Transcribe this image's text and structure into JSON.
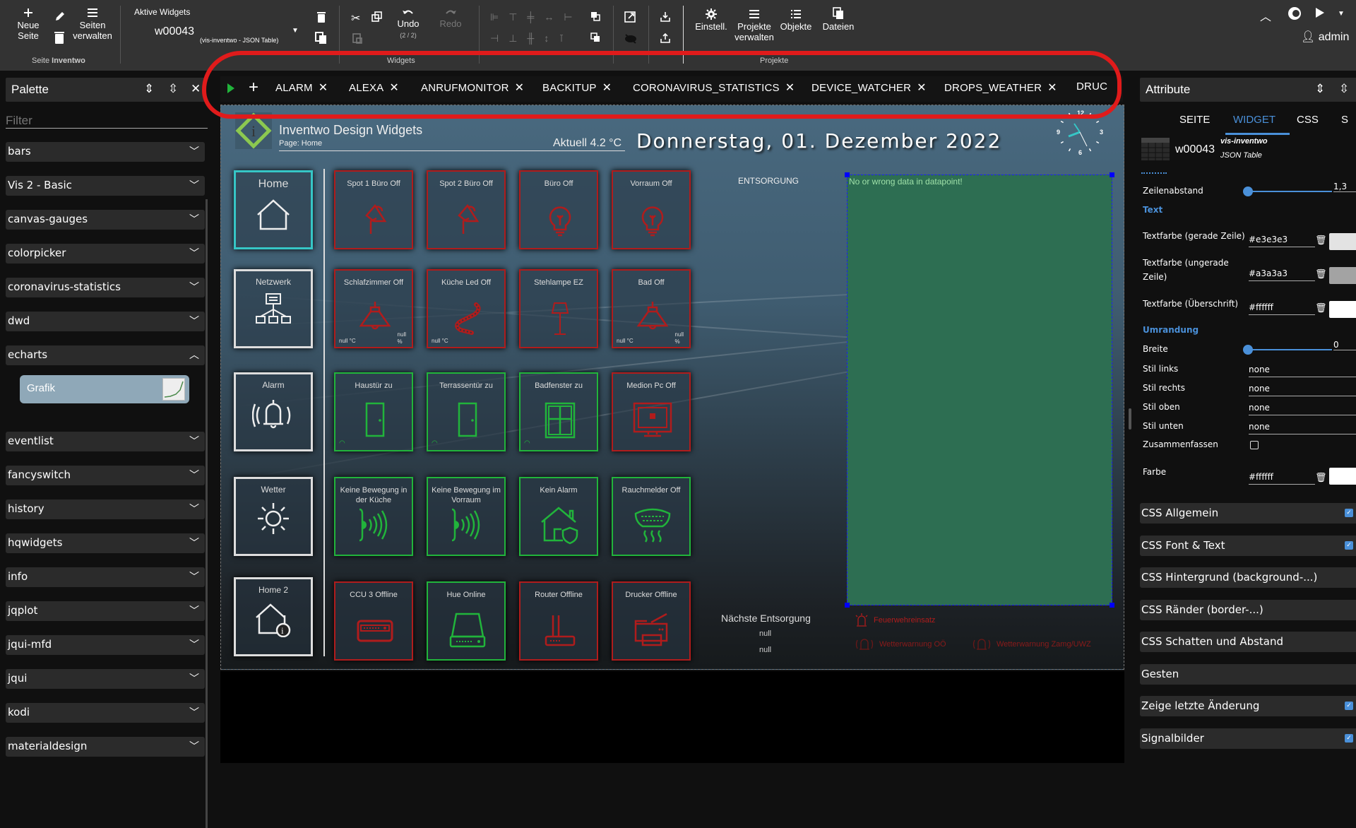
{
  "toolbar": {
    "new_page": "Neue\nSeite",
    "manage_pages": "Seiten\nverwalten",
    "page_group_prefix": "Seite",
    "page_group_name": "Inventwo",
    "active_widgets_label": "Aktive Widgets",
    "active_widget_id": "w00043",
    "active_widget_type": "(vis-inventwo - JSON Table)",
    "undo_label": "Undo",
    "undo_count": "(2 / 2)",
    "redo_label": "Redo",
    "widgets_group": "Widgets",
    "settings_label": "Einstell.",
    "manage_projects": "Projekte\nverwalten",
    "objects_label": "Objekte",
    "files_label": "Dateien",
    "projects_group": "Projekte",
    "user": "admin"
  },
  "palette": {
    "title": "Palette",
    "filter_label": "Filter",
    "items": [
      {
        "label": "bars",
        "expanded": false
      },
      {
        "label": "Vis 2 - Basic",
        "expanded": false
      },
      {
        "label": "canvas-gauges",
        "expanded": false
      },
      {
        "label": "colorpicker",
        "expanded": false
      },
      {
        "label": "coronavirus-statistics",
        "expanded": false
      },
      {
        "label": "dwd",
        "expanded": false
      },
      {
        "label": "echarts",
        "expanded": true
      },
      {
        "label": "eventlist",
        "expanded": false
      },
      {
        "label": "fancyswitch",
        "expanded": false
      },
      {
        "label": "history",
        "expanded": false
      },
      {
        "label": "hqwidgets",
        "expanded": false
      },
      {
        "label": "info",
        "expanded": false
      },
      {
        "label": "jqplot",
        "expanded": false
      },
      {
        "label": "jqui-mfd",
        "expanded": false
      },
      {
        "label": "jqui",
        "expanded": false
      },
      {
        "label": "kodi",
        "expanded": false
      },
      {
        "label": "materialdesign",
        "expanded": false
      }
    ],
    "echarts_widget": "Grafik"
  },
  "tabs": [
    "ALARM",
    "ALEXA",
    "ANRUFMONITOR",
    "BACKITUP",
    "CORONAVIRUS_STATISTICS",
    "DEVICE_WATCHER",
    "DROPS_WEATHER",
    "DRUC"
  ],
  "canvas": {
    "app_title": "Inventwo Design Widgets",
    "page_label": "Page: Home",
    "temperature": "Aktuell 4.2 °C",
    "date": "Donnerstag, 01. Dezember 2022",
    "clock_numbers": [
      "12",
      "3",
      "6",
      "9"
    ],
    "nav": [
      {
        "label": "Home",
        "icon": "home-icon",
        "active": true
      },
      {
        "label": "Netzwerk",
        "icon": "network-icon",
        "active": false
      },
      {
        "label": "Alarm",
        "icon": "bell-icon",
        "active": false
      },
      {
        "label": "Wetter",
        "icon": "sun-icon",
        "active": false
      },
      {
        "label": "Home 2",
        "icon": "home-info-icon",
        "active": false
      }
    ],
    "devices": [
      {
        "label": "Spot 1 Büro Off",
        "state": "red",
        "icon": "spotlight-icon"
      },
      {
        "label": "Spot 2 Büro Off",
        "state": "red",
        "icon": "spotlight-icon"
      },
      {
        "label": "Büro Off",
        "state": "red",
        "icon": "bulb-icon"
      },
      {
        "label": "Vorraum Off",
        "state": "red",
        "icon": "bulb-icon"
      },
      {
        "label": "Schlafzimmer Off",
        "state": "red",
        "icon": "ceiling-lamp-icon",
        "temp": "null °C",
        "hum": "null\n%"
      },
      {
        "label": "Küche Led Off",
        "state": "red",
        "icon": "led-strip-icon",
        "temp": "null °C"
      },
      {
        "label": "Stehlampe EZ",
        "state": "red",
        "icon": "floor-lamp-icon"
      },
      {
        "label": "Bad Off",
        "state": "red",
        "icon": "ceiling-lamp-icon",
        "temp": "null °C",
        "hum": "null\n%"
      },
      {
        "label": "Haustür zu",
        "state": "green",
        "icon": "door-icon",
        "wifi": true
      },
      {
        "label": "Terrassentür zu",
        "state": "green",
        "icon": "door-icon",
        "wifi": true
      },
      {
        "label": "Badfenster zu",
        "state": "green",
        "icon": "window-icon",
        "wifi": true
      },
      {
        "label": "Medion Pc Off",
        "state": "red",
        "icon": "monitor-icon"
      },
      {
        "label": "Keine Bewegung in der Küche",
        "state": "green",
        "icon": "motion-icon"
      },
      {
        "label": "Keine Bewegung im Vorraum",
        "state": "green",
        "icon": "motion-icon"
      },
      {
        "label": "Kein Alarm",
        "state": "green",
        "icon": "house-shield-icon"
      },
      {
        "label": "Rauchmelder Off",
        "state": "green",
        "icon": "smoke-detector-icon"
      },
      {
        "label": "CCU 3 Offline",
        "state": "red",
        "icon": "ccu-icon"
      },
      {
        "label": "Hue Online",
        "state": "green",
        "icon": "hue-bridge-icon"
      },
      {
        "label": "Router Offline",
        "state": "red",
        "icon": "router-icon"
      },
      {
        "label": "Drucker Offline",
        "state": "red",
        "icon": "printer-icon"
      }
    ],
    "entsorgung_title": "ENTSORGUNG",
    "json_table_message": "No or wrong data in datapoint!",
    "next_disposal_label": "Nächste Entsorgung",
    "next_disposal_values": [
      "null",
      "null"
    ],
    "alerts": [
      "Feuerwehreinsatz",
      "Wetterwarnung OÖ",
      "Wetterwarnung Zamg/UWZ"
    ]
  },
  "attributes": {
    "title": "Attribute",
    "tabs": [
      "SEITE",
      "WIDGET",
      "CSS",
      "S"
    ],
    "active_tab": "WIDGET",
    "widget_id": "w00043",
    "widget_set": "vis-inventwo",
    "widget_type": "JSON Table",
    "line_spacing_label": "Zeilenabstand",
    "line_spacing_value": "1,3",
    "text_section": "Text",
    "text_even_label": "Textfarbe (gerade Zeile)",
    "text_even_value": "#e3e3e3",
    "text_odd_label": "Textfarbe (ungerade Zeile)",
    "text_odd_value": "#a3a3a3",
    "text_header_label": "Textfarbe (Überschrift)",
    "text_header_value": "#ffffff",
    "border_section": "Umrandung",
    "width_label": "Breite",
    "width_value": "0",
    "style_left_label": "Stil links",
    "style_left_value": "none",
    "style_right_label": "Stil rechts",
    "style_right_value": "none",
    "style_top_label": "Stil oben",
    "style_top_value": "none",
    "style_bottom_label": "Stil unten",
    "style_bottom_value": "none",
    "collapse_label": "Zusammenfassen",
    "color_label": "Farbe",
    "color_value": "#ffffff",
    "accordions": [
      {
        "label": "CSS Allgemein",
        "checked": true
      },
      {
        "label": "CSS Font & Text",
        "checked": true
      },
      {
        "label": "CSS Hintergrund (background-...)",
        "checked": false
      },
      {
        "label": "CSS Ränder (border-...)",
        "checked": false
      },
      {
        "label": "CSS Schatten und Abstand",
        "checked": false
      },
      {
        "label": "Gesten",
        "checked": false
      },
      {
        "label": "Zeige letzte Änderung",
        "checked": true
      },
      {
        "label": "Signalbilder",
        "checked": true
      }
    ]
  },
  "colors": {
    "accent": "#4a90d9",
    "off_red": "#b01c1c",
    "on_green": "#21b43b",
    "active_nav": "#36c6c6"
  }
}
